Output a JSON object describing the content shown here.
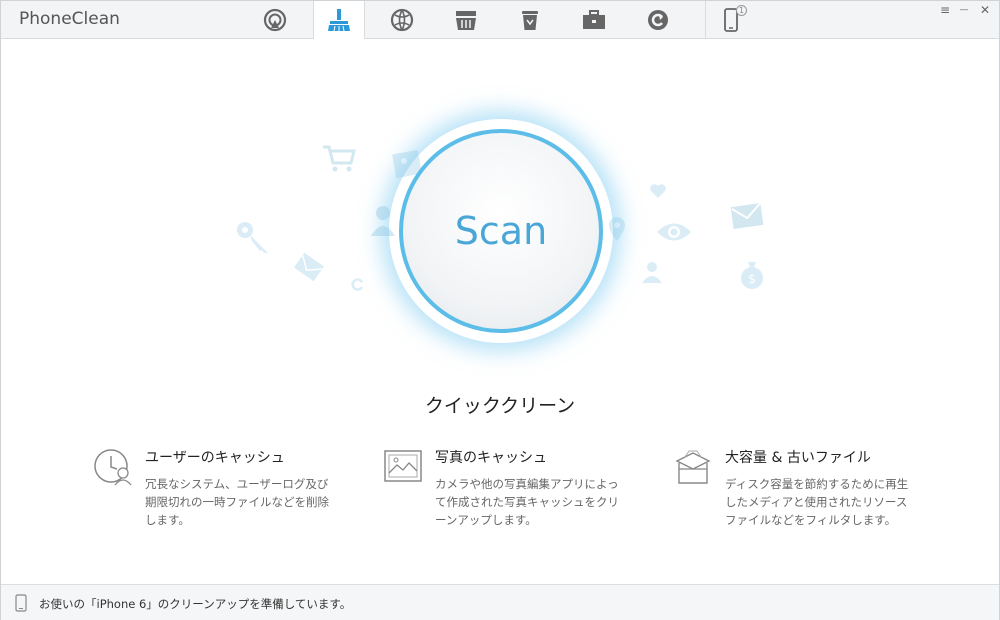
{
  "app": {
    "title": "PhoneClean"
  },
  "toolbar": {
    "tabs": [
      {
        "icon": "airplay-icon"
      },
      {
        "icon": "broom-icon",
        "active": true
      },
      {
        "icon": "internet-icon"
      },
      {
        "icon": "basket-icon"
      },
      {
        "icon": "trash-icon"
      },
      {
        "icon": "toolbox-icon"
      },
      {
        "icon": "backup-icon"
      }
    ],
    "device_count": "1"
  },
  "window_controls": {
    "menu": "≡",
    "minimize": "—",
    "close": "✕"
  },
  "scan": {
    "label": "Scan"
  },
  "section": {
    "title": "クイッククリーン"
  },
  "features": [
    {
      "icon": "clock-user-icon",
      "name": "ユーザーのキャッシュ",
      "desc": "冗長なシステム、ユーザーログ及び期限切れの一時ファイルなどを削除します。"
    },
    {
      "icon": "photo-icon",
      "name": "写真のキャッシュ",
      "desc": "カメラや他の写真編集アプリによって作成された写真キャッシュをクリーンアップします。"
    },
    {
      "icon": "box-icon",
      "name": "大容量 & 古いファイル",
      "desc": "ディスク容量を節約するために再生したメディアと使用されたリソースファイルなどをフィルタします。"
    }
  ],
  "status": {
    "text": "お使いの「iPhone 6」のクリーンアップを準備しています。"
  },
  "colors": {
    "accent": "#4aa6d6",
    "ring": "#5cbde8",
    "deco": "#d6ebf5"
  }
}
